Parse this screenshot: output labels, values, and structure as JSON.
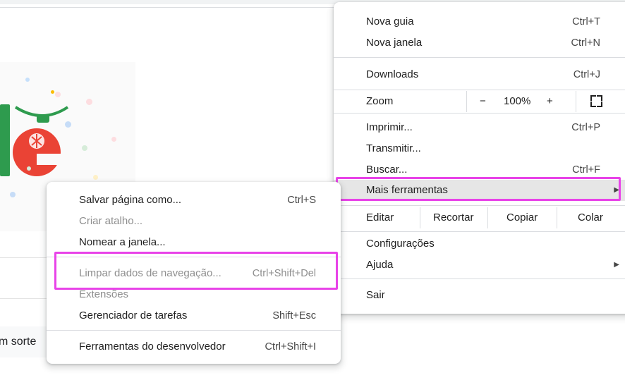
{
  "background": {
    "lucky_button": "m sorte"
  },
  "main_menu": {
    "items": [
      {
        "label": "Nova guia",
        "shortcut": "Ctrl+T"
      },
      {
        "label": "Nova janela",
        "shortcut": "Ctrl+N"
      },
      {
        "label": "Downloads",
        "shortcut": "Ctrl+J"
      },
      {
        "label": "Imprimir...",
        "shortcut": "Ctrl+P"
      },
      {
        "label": "Transmitir...",
        "shortcut": ""
      },
      {
        "label": "Buscar...",
        "shortcut": "Ctrl+F"
      },
      {
        "label": "Mais ferramentas",
        "shortcut": ""
      },
      {
        "label": "Configurações",
        "shortcut": ""
      },
      {
        "label": "Ajuda",
        "shortcut": ""
      },
      {
        "label": "Sair",
        "shortcut": ""
      }
    ],
    "zoom": {
      "label": "Zoom",
      "minus": "−",
      "value": "100%",
      "plus": "+"
    },
    "edit": {
      "label": "Editar",
      "cut": "Recortar",
      "copy": "Copiar",
      "paste": "Colar"
    },
    "submenu_arrow": "▶"
  },
  "sub_menu": {
    "items": [
      {
        "label": "Salvar página como...",
        "shortcut": "Ctrl+S"
      },
      {
        "label": "Criar atalho...",
        "shortcut": ""
      },
      {
        "label": "Nomear a janela...",
        "shortcut": ""
      },
      {
        "label": "Limpar dados de navegação...",
        "shortcut": "Ctrl+Shift+Del"
      },
      {
        "label": "Extensões",
        "shortcut": ""
      },
      {
        "label": "Gerenciador de tarefas",
        "shortcut": "Shift+Esc"
      },
      {
        "label": "Ferramentas do desenvolvedor",
        "shortcut": "Ctrl+Shift+I"
      }
    ]
  },
  "colors": {
    "highlight": "#e843e8",
    "hover": "#e6e6e6",
    "disabled_text": "#8e8e8e",
    "doodle_green": "#2e9b4e",
    "doodle_red": "#ea4335"
  }
}
